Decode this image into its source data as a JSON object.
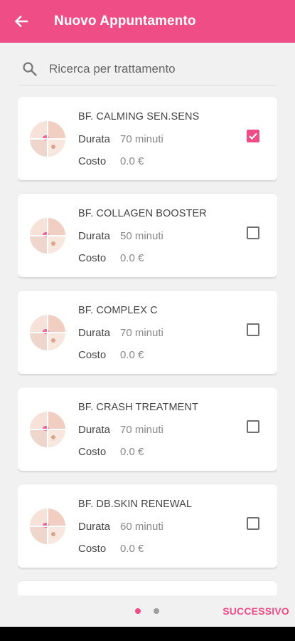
{
  "appbar": {
    "title": "Nuovo Appuntamento"
  },
  "search": {
    "placeholder": "Ricerca per trattamento"
  },
  "labels": {
    "duration": "Durata",
    "cost": "Costo"
  },
  "treatments": [
    {
      "name": "BF. CALMING SEN.SENS",
      "duration": "70 minuti",
      "cost": "0.0 €",
      "selected": true
    },
    {
      "name": "BF. COLLAGEN BOOSTER",
      "duration": "50 minuti",
      "cost": "0.0 €",
      "selected": false
    },
    {
      "name": "BF. COMPLEX C",
      "duration": "70 minuti",
      "cost": "0.0 €",
      "selected": false
    },
    {
      "name": "BF. CRASH TREATMENT",
      "duration": "70 minuti",
      "cost": "0.0 €",
      "selected": false
    },
    {
      "name": "BF. DB.SKIN RENEWAL",
      "duration": "60 minuti",
      "cost": "0.0 €",
      "selected": false
    }
  ],
  "footer": {
    "next_label": "SUCCESSIVO",
    "current_page": 1,
    "total_pages": 2
  },
  "colors": {
    "accent": "#ee4d85"
  }
}
